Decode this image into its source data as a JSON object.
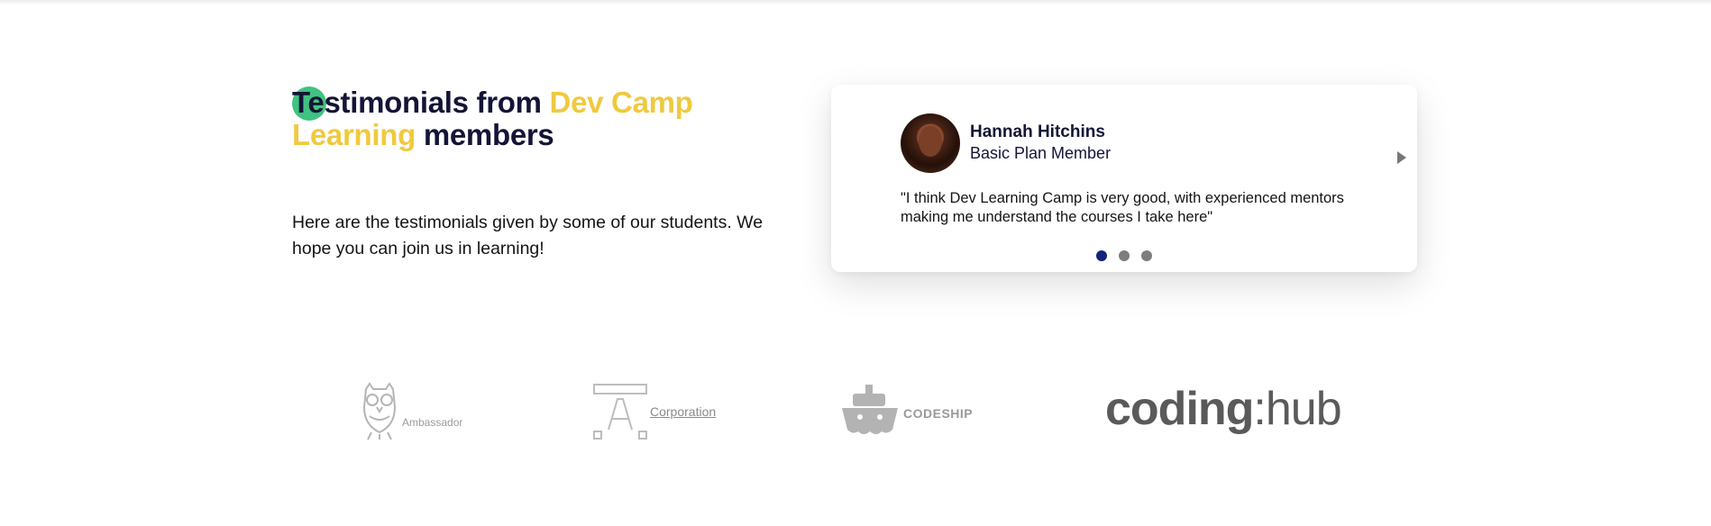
{
  "testimonials": {
    "heading": {
      "part1": "Testimonials from ",
      "highlight": "Dev Camp Learning",
      "part2": " members"
    },
    "intro": "Here are the testimonials given by some of our students. We hope you can join us in learning!",
    "card": {
      "name": "Hannah Hitchins",
      "role": "Basic Plan Member",
      "quote": "\"I think Dev Learning Camp is very good, with experienced mentors making me understand the courses I take here\"",
      "active_slide": 1,
      "slide_count": 3
    }
  },
  "partners": {
    "ambassador": "Ambassador",
    "corporation": "Corporation",
    "codeship": "CODESHIP",
    "codinghub": {
      "part1": "coding",
      "part2": ":hub"
    }
  },
  "colors": {
    "accent_yellow": "#f0c93e",
    "accent_green": "#3fc380",
    "navy": "#141437",
    "active_dot": "#15237a"
  },
  "icons": {
    "next": "chevron-right-icon"
  }
}
